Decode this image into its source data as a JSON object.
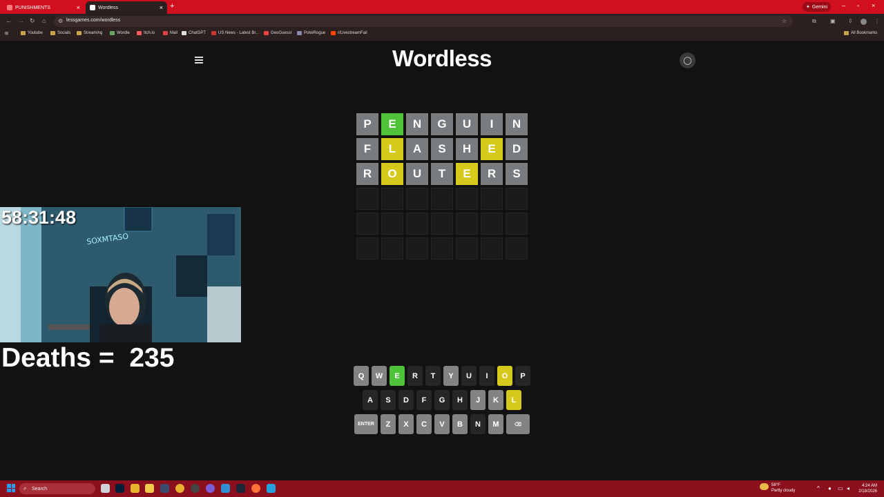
{
  "browser": {
    "tabs": [
      {
        "label": "PUNISHMENTS",
        "favicon_color": "#ff7a7a"
      },
      {
        "label": "Wordless",
        "favicon_color": "#ffffff"
      }
    ],
    "url": "lessgames.com/wordless",
    "gemini_label": "Gemini",
    "bookmarks": [
      {
        "label": "Youtube",
        "icon": "folder-icon"
      },
      {
        "label": "Socials",
        "icon": "folder-icon"
      },
      {
        "label": "Streaming",
        "icon": "folder-icon"
      },
      {
        "label": "Wordle",
        "icon": "wordle-icon"
      },
      {
        "label": "Itch.io",
        "icon": "itch-icon"
      },
      {
        "label": "Mail",
        "icon": "mail-icon"
      },
      {
        "label": "ChatGPT",
        "icon": "chatgpt-icon"
      },
      {
        "label": "US News - Latest Br...",
        "icon": "news-icon"
      },
      {
        "label": "GeoGuessr",
        "icon": "geoguessr-icon"
      },
      {
        "label": "PokéRogue",
        "icon": "pokerogue-icon"
      },
      {
        "label": "r/LivestreamFail",
        "icon": "reddit-icon"
      }
    ],
    "all_bookmarks_label": "All Bookmarks"
  },
  "page": {
    "title": "Wordless"
  },
  "board": {
    "rows": [
      [
        {
          "l": "P",
          "s": "absent"
        },
        {
          "l": "E",
          "s": "correct"
        },
        {
          "l": "N",
          "s": "absent"
        },
        {
          "l": "G",
          "s": "absent"
        },
        {
          "l": "U",
          "s": "absent"
        },
        {
          "l": "I",
          "s": "absent"
        },
        {
          "l": "N",
          "s": "absent"
        }
      ],
      [
        {
          "l": "F",
          "s": "absent"
        },
        {
          "l": "L",
          "s": "present"
        },
        {
          "l": "A",
          "s": "absent"
        },
        {
          "l": "S",
          "s": "absent"
        },
        {
          "l": "H",
          "s": "absent"
        },
        {
          "l": "E",
          "s": "present"
        },
        {
          "l": "D",
          "s": "absent"
        }
      ],
      [
        {
          "l": "R",
          "s": "absent"
        },
        {
          "l": "O",
          "s": "present"
        },
        {
          "l": "U",
          "s": "absent"
        },
        {
          "l": "T",
          "s": "absent"
        },
        {
          "l": "E",
          "s": "present"
        },
        {
          "l": "R",
          "s": "absent"
        },
        {
          "l": "S",
          "s": "absent"
        }
      ],
      [
        {
          "l": "",
          "s": "empty"
        },
        {
          "l": "",
          "s": "empty"
        },
        {
          "l": "",
          "s": "empty"
        },
        {
          "l": "",
          "s": "empty"
        },
        {
          "l": "",
          "s": "empty"
        },
        {
          "l": "",
          "s": "empty"
        },
        {
          "l": "",
          "s": "empty"
        }
      ],
      [
        {
          "l": "",
          "s": "empty"
        },
        {
          "l": "",
          "s": "empty"
        },
        {
          "l": "",
          "s": "empty"
        },
        {
          "l": "",
          "s": "empty"
        },
        {
          "l": "",
          "s": "empty"
        },
        {
          "l": "",
          "s": "empty"
        },
        {
          "l": "",
          "s": "empty"
        }
      ],
      [
        {
          "l": "",
          "s": "empty"
        },
        {
          "l": "",
          "s": "empty"
        },
        {
          "l": "",
          "s": "empty"
        },
        {
          "l": "",
          "s": "empty"
        },
        {
          "l": "",
          "s": "empty"
        },
        {
          "l": "",
          "s": "empty"
        },
        {
          "l": "",
          "s": "empty"
        }
      ]
    ]
  },
  "keyboard": {
    "rows": [
      [
        {
          "k": "Q",
          "s": "mid"
        },
        {
          "k": "W",
          "s": "mid"
        },
        {
          "k": "E",
          "s": "correct"
        },
        {
          "k": "R",
          "s": "dark"
        },
        {
          "k": "T",
          "s": "dark"
        },
        {
          "k": "Y",
          "s": "mid"
        },
        {
          "k": "U",
          "s": "dark"
        },
        {
          "k": "I",
          "s": "dark"
        },
        {
          "k": "O",
          "s": "present"
        },
        {
          "k": "P",
          "s": "dark"
        }
      ],
      [
        {
          "k": "A",
          "s": "dark"
        },
        {
          "k": "S",
          "s": "dark"
        },
        {
          "k": "D",
          "s": "dark"
        },
        {
          "k": "F",
          "s": "dark"
        },
        {
          "k": "G",
          "s": "dark"
        },
        {
          "k": "H",
          "s": "dark"
        },
        {
          "k": "J",
          "s": "mid"
        },
        {
          "k": "K",
          "s": "mid"
        },
        {
          "k": "L",
          "s": "present"
        }
      ],
      [
        {
          "k": "ENTER",
          "s": "mid",
          "wide": true
        },
        {
          "k": "Z",
          "s": "mid"
        },
        {
          "k": "X",
          "s": "mid"
        },
        {
          "k": "C",
          "s": "mid"
        },
        {
          "k": "V",
          "s": "mid"
        },
        {
          "k": "B",
          "s": "mid"
        },
        {
          "k": "N",
          "s": "dark"
        },
        {
          "k": "M",
          "s": "mid"
        },
        {
          "k": "⌫",
          "s": "mid",
          "wide": true
        }
      ]
    ]
  },
  "overlay": {
    "timer": "58:31:48",
    "deaths_label": "Deaths =  235"
  },
  "taskbar": {
    "search_placeholder": "Search",
    "weather_temp": "58°F",
    "weather_desc": "Partly cloudy",
    "time": "4:24 AM",
    "date": "2/18/2026"
  },
  "colors": {
    "correct": "#4ec239",
    "present": "#d7c91c",
    "absent": "#787c7e",
    "browser_accent": "#d10f1f"
  }
}
